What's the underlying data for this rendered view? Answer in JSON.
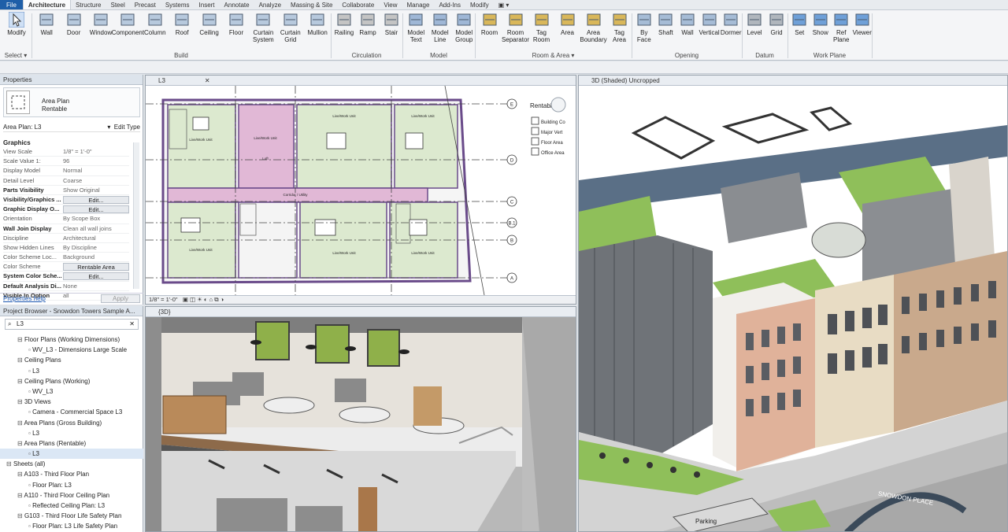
{
  "tabs": [
    "File",
    "Architecture",
    "Structure",
    "Steel",
    "Precast",
    "Systems",
    "Insert",
    "Annotate",
    "Analyze",
    "Massing & Site",
    "Collaborate",
    "View",
    "Manage",
    "Add-Ins",
    "Modify"
  ],
  "active_tab": "Architecture",
  "ribbon": {
    "modify": "Modify",
    "select": "Select ▾",
    "build": [
      "Wall",
      "Door",
      "Window",
      "Component",
      "Column",
      "Roof",
      "Ceiling",
      "Floor",
      "Curtain\nSystem",
      "Curtain\nGrid",
      "Mullion"
    ],
    "circulation": [
      "Railing",
      "Ramp",
      "Stair"
    ],
    "model": [
      "Model\nText",
      "Model\nLine",
      "Model\nGroup"
    ],
    "room_area": [
      "Room",
      "Room\nSeparator",
      "Tag\nRoom",
      "Area",
      "Area\nBoundary",
      "Tag\nArea"
    ],
    "opening": [
      "By\nFace",
      "Shaft",
      "Wall",
      "Vertical",
      "Dormer"
    ],
    "datum": [
      "Level",
      "Grid"
    ],
    "work_plane": [
      "Set",
      "Show",
      "Ref\nPlane",
      "Viewer"
    ],
    "panels": {
      "select": "Select ▾",
      "build": "Build",
      "circulation": "Circulation",
      "model": "Model",
      "room_area": "Room & Area ▾",
      "opening": "Opening",
      "datum": "Datum",
      "work_plane": "Work Plane"
    }
  },
  "properties": {
    "header": "Properties",
    "type_name": "Area Plan",
    "type_sub": "Rentable",
    "selector": "Area Plan: L3",
    "edit_type": "Edit Type",
    "group": "Graphics",
    "rows": [
      {
        "k": "View Scale",
        "v": "1/8\" = 1'-0\""
      },
      {
        "k": "Scale Value  1:",
        "v": "96"
      },
      {
        "k": "Display Model",
        "v": "Normal"
      },
      {
        "k": "Detail Level",
        "v": "Coarse"
      },
      {
        "k": "Parts Visibility",
        "v": "Show Original"
      },
      {
        "k": "Visibility/Graphics ...",
        "v": "Edit..."
      },
      {
        "k": "Graphic Display O...",
        "v": "Edit..."
      },
      {
        "k": "Orientation",
        "v": "By Scope Box"
      },
      {
        "k": "Wall Join Display",
        "v": "Clean all wall joins"
      },
      {
        "k": "Discipline",
        "v": "Architectural"
      },
      {
        "k": "Show Hidden Lines",
        "v": "By Discipline"
      },
      {
        "k": "Color Scheme Loc...",
        "v": "Background"
      },
      {
        "k": "Color Scheme",
        "v": "Rentable Area"
      },
      {
        "k": "System Color Sche...",
        "v": "Edit..."
      },
      {
        "k": "Default Analysis Di...",
        "v": "None"
      },
      {
        "k": "Visible In Option",
        "v": "all"
      }
    ],
    "help": "Properties help",
    "apply": "Apply"
  },
  "browser": {
    "header": "Project Browser - Snowdon Towers Sample A...",
    "search": "L3",
    "items": [
      {
        "t": "Floor Plans (Working Dimensions)",
        "d": 1
      },
      {
        "t": "WV_L3 - Dimensions Large Scale",
        "d": 2
      },
      {
        "t": "Ceiling Plans",
        "d": 1
      },
      {
        "t": "L3",
        "d": 2
      },
      {
        "t": "Ceiling Plans (Working)",
        "d": 1
      },
      {
        "t": "WV_L3",
        "d": 2
      },
      {
        "t": "3D Views",
        "d": 1
      },
      {
        "t": "Camera - Commercial Space L3",
        "d": 2
      },
      {
        "t": "Area Plans (Gross Building)",
        "d": 1
      },
      {
        "t": "L3",
        "d": 2
      },
      {
        "t": "Area Plans (Rentable)",
        "d": 1
      },
      {
        "t": "L3",
        "d": 2,
        "sel": true
      },
      {
        "t": "Sheets (all)",
        "d": 0
      },
      {
        "t": "A103 - Third Floor Plan",
        "d": 1
      },
      {
        "t": "Floor Plan: L3",
        "d": 2
      },
      {
        "t": "A110 - Third Floor Ceiling Plan",
        "d": 1
      },
      {
        "t": "Reflected Ceiling Plan: L3",
        "d": 2
      },
      {
        "t": "G103 - Third Floor Life Safety Plan",
        "d": 1
      },
      {
        "t": "Floor Plan: L3 Life Safety Plan",
        "d": 2
      }
    ]
  },
  "views": {
    "plan_tab": "L3",
    "plan_scale": "1/8\" = 1'-0\"",
    "legend_title": "Rentable",
    "legend_items": [
      "Building Co",
      "Major Vert",
      "Floor Area",
      "Office Area"
    ],
    "grid_labels": [
      "E",
      "D",
      "C",
      "B.1",
      "B",
      "A"
    ],
    "room_labels": [
      "Live/Work Unit",
      "Live/Work Unit",
      "Live/Work Unit",
      "Loft",
      "Corridor / Utility",
      "Live/Work Unit",
      "Live/Work Unit",
      "Live/Work Unit",
      "Live/Work Unit"
    ],
    "section_tab": "{3D}",
    "shaded_tab": "3D (Shaded) Uncropped",
    "sign": "SNOWDON PLACE",
    "parking": "Parking"
  },
  "colors": {
    "accent": "#1f5fa8",
    "plan_room": "#dce9cf",
    "plan_corridor": "#e1b8d6",
    "plan_wall": "#6a4b8a",
    "sky": "#ffffff"
  }
}
